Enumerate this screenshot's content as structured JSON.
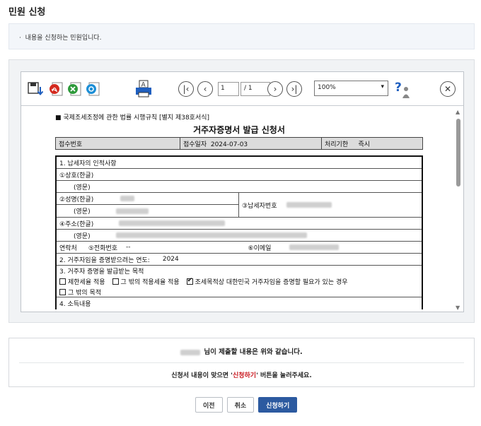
{
  "page": {
    "title": "민원 신청"
  },
  "notice": {
    "text": "내용을 신청하는 민원입니다."
  },
  "viewer": {
    "toolbar": {
      "page_current": "1",
      "page_total": "/ 1",
      "zoom": "100%"
    },
    "document": {
      "caption": "■ 국제조세조정에 관한 법률 시행규칙 [별지 제38호서식]",
      "title": "거주자증명서 발급 신청서",
      "receipt": {
        "no_label": "접수번호",
        "date_label": "접수일자",
        "date_value": "2024-07-03",
        "period_label": "처리기한",
        "period_value": "즉시"
      },
      "sec1": {
        "heading": "1. 납세자의 인적사항",
        "name_kor": "①상호(한글)",
        "name_eng": "(영문)",
        "person_kor": "②성명(한글)",
        "person_eng": "(영문)",
        "taxpayer_no": "③납세자번호",
        "addr_kor": "④주소(한글)",
        "addr_eng": "(영문)",
        "contact": "연락처",
        "phone": "⑤전화번호",
        "phone_value": "--",
        "email": "⑥이메일"
      },
      "sec2": {
        "label": "2. 거주자임을 증명받으려는 연도:",
        "value": "2024"
      },
      "sec3": {
        "heading": "3. 거주자 증명을 발급받는 목적",
        "opt1": "제한세율 적용",
        "opt2": "그 밖의 적용세율 적용",
        "opt3": "조세목적상 대한민국 거주자임을 증명할 필요가 있는 경우",
        "opt4": "그 밖의 목적"
      },
      "sec4": {
        "heading": "4. 소득내용"
      }
    }
  },
  "summary": {
    "line1_suffix": "님이 제출할 내용은 위와 같습니다.",
    "line2_prefix": "신청서 내용이 맞으면 '",
    "line2_highlight": "신청하기",
    "line2_suffix": "' 버튼을 눌러주세요."
  },
  "buttons": {
    "prev": "이전",
    "cancel": "취소",
    "submit": "신청하기"
  },
  "colors": {
    "primary": "#2c5aa0",
    "highlight": "#c8161d"
  }
}
